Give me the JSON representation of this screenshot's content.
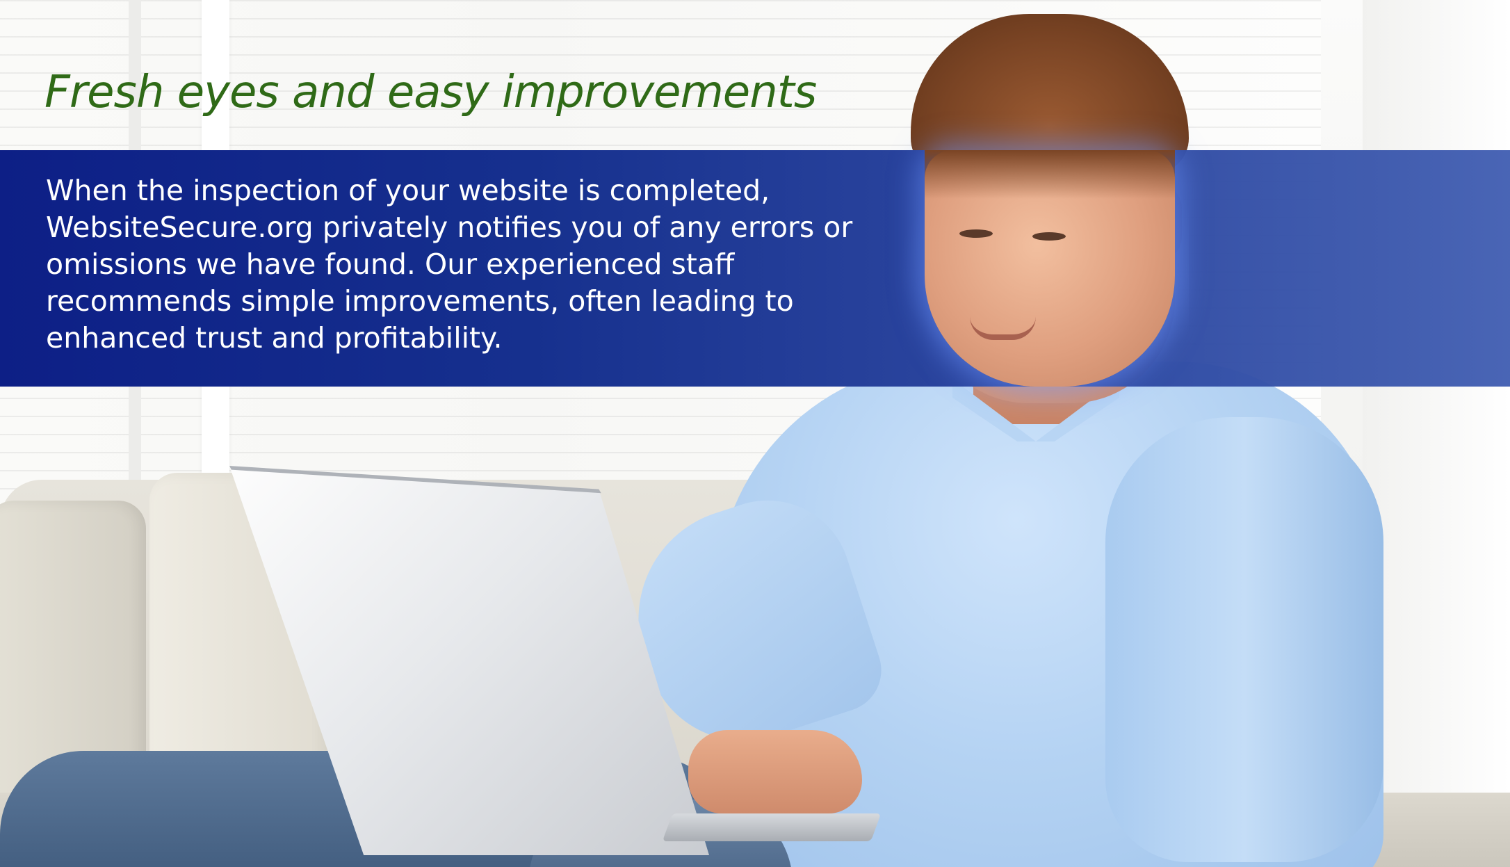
{
  "headline": "Fresh eyes and easy improvements",
  "body": {
    "lines": [
      "When the inspection of your website is completed,",
      "WebsiteSecure.org privately notifies you of any errors or",
      "omissions we have found. Our experienced staff",
      "recommends simple improvements, often leading to",
      "enhanced trust and profitability."
    ]
  },
  "colors": {
    "headline": "#2f6a17",
    "banner_start": "#0d1f86",
    "banner_end": "#3a58af",
    "body_text": "#ffffff"
  },
  "photo": {
    "subject": "man-using-laptop-photo"
  }
}
